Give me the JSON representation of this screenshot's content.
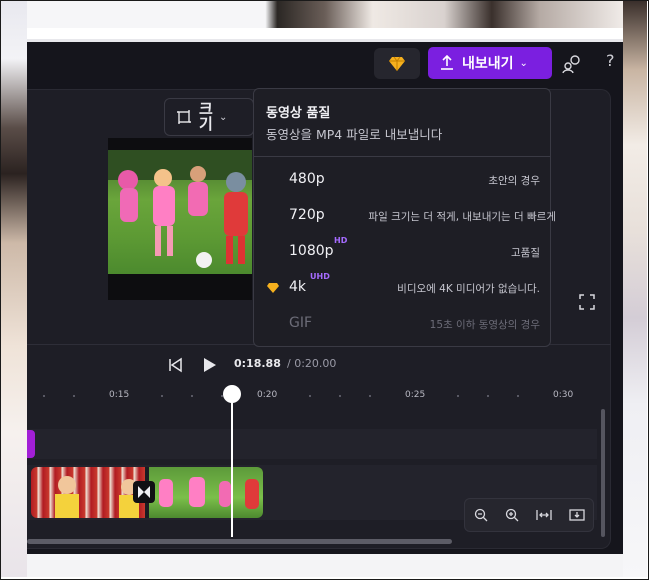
{
  "export": {
    "button_label": "내보내기",
    "dropdown": {
      "title": "동영상 품질",
      "subtitle": "동영상을 MP4 파일로 내보냅니다",
      "options": [
        {
          "name": "480p",
          "badge": "",
          "desc": "초안의 경우",
          "premium": false,
          "disabled": false
        },
        {
          "name": "720p",
          "badge": "",
          "desc": "파일 크기는 더 적게, 내보내기는 더 빠르게",
          "premium": false,
          "disabled": false
        },
        {
          "name": "1080p",
          "badge": "HD",
          "desc": "고품질",
          "premium": false,
          "disabled": false
        },
        {
          "name": "4k",
          "badge": "UHD",
          "desc": "비디오에 4K 미디어가 없습니다.",
          "premium": true,
          "disabled": false
        },
        {
          "name": "GIF",
          "badge": "",
          "desc": "15초 이하 동영상의 경우",
          "premium": false,
          "disabled": true
        }
      ]
    }
  },
  "toolbar": {
    "resize_label": "크기",
    "help_label": "?"
  },
  "playback": {
    "current_time": "0:18.88",
    "total_time": "/ 0:20.00"
  },
  "timeline": {
    "ruler_labels": [
      "0:15",
      "0:20",
      "0:25",
      "0:30"
    ]
  },
  "colors": {
    "accent": "#7b1fe0",
    "premium_gold": "#f5b01e",
    "badge_purple": "#a56bff",
    "track_handle": "#a21fd6"
  },
  "icons": {
    "diamond": "diamond-icon",
    "export": "upload-icon",
    "share": "collaborate-icon",
    "resize": "crop-icon",
    "skip_back": "skip-back-icon",
    "play": "play-icon",
    "fullscreen": "fullscreen-icon",
    "zoom_out": "zoom-out-icon",
    "zoom_in": "zoom-in-icon",
    "fit": "fit-width-icon",
    "insert": "insert-icon"
  }
}
